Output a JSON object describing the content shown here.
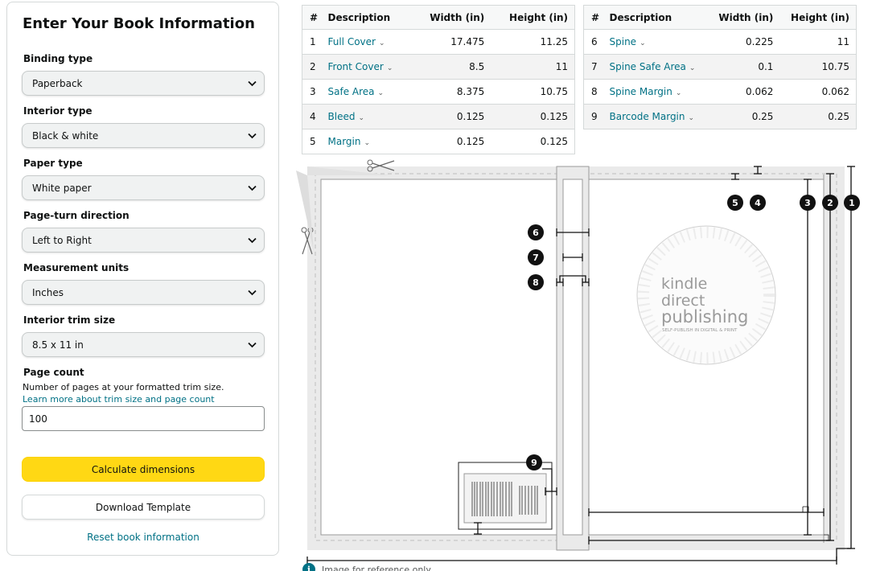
{
  "form": {
    "title": "Enter Your Book Information",
    "binding_type": {
      "label": "Binding type",
      "value": "Paperback"
    },
    "interior_type": {
      "label": "Interior type",
      "value": "Black & white"
    },
    "paper_type": {
      "label": "Paper type",
      "value": "White paper"
    },
    "page_turn": {
      "label": "Page-turn direction",
      "value": "Left to Right"
    },
    "units": {
      "label": "Measurement units",
      "value": "Inches"
    },
    "trim_size": {
      "label": "Interior trim size",
      "value": "8.5 x 11 in"
    },
    "page_count": {
      "label": "Page count",
      "help": "Number of pages at your formatted trim size.",
      "link": "Learn more about trim size and page count",
      "value": "100"
    },
    "calculate_label": "Calculate dimensions",
    "download_label": "Download Template",
    "reset_label": "Reset book information"
  },
  "table_headers": {
    "num": "#",
    "desc": "Description",
    "width": "Width (in)",
    "height": "Height (in)"
  },
  "table1": [
    {
      "n": "1",
      "desc": "Full Cover",
      "w": "17.475",
      "h": "11.25"
    },
    {
      "n": "2",
      "desc": "Front Cover",
      "w": "8.5",
      "h": "11"
    },
    {
      "n": "3",
      "desc": "Safe Area",
      "w": "8.375",
      "h": "10.75"
    },
    {
      "n": "4",
      "desc": "Bleed",
      "w": "0.125",
      "h": "0.125"
    },
    {
      "n": "5",
      "desc": "Margin",
      "w": "0.125",
      "h": "0.125"
    }
  ],
  "table2": [
    {
      "n": "6",
      "desc": "Spine",
      "w": "0.225",
      "h": "11"
    },
    {
      "n": "7",
      "desc": "Spine Safe Area",
      "w": "0.1",
      "h": "10.75"
    },
    {
      "n": "8",
      "desc": "Spine Margin",
      "w": "0.062",
      "h": "0.062"
    },
    {
      "n": "9",
      "desc": "Barcode Margin",
      "w": "0.25",
      "h": "0.25"
    }
  ],
  "diagram": {
    "logo_line1": "kindle",
    "logo_line2": "direct",
    "logo_line3": "publishing",
    "logo_tagline": "SELF-PUBLISH IN DIGITAL & PRINT",
    "markers": [
      "1",
      "2",
      "3",
      "4",
      "5",
      "6",
      "7",
      "8",
      "9"
    ]
  },
  "reference_note": "Image for reference only",
  "colors": {
    "accent_link": "#007185",
    "primary_button": "#ffd814",
    "diagram_bleed": "#eaeaea"
  }
}
